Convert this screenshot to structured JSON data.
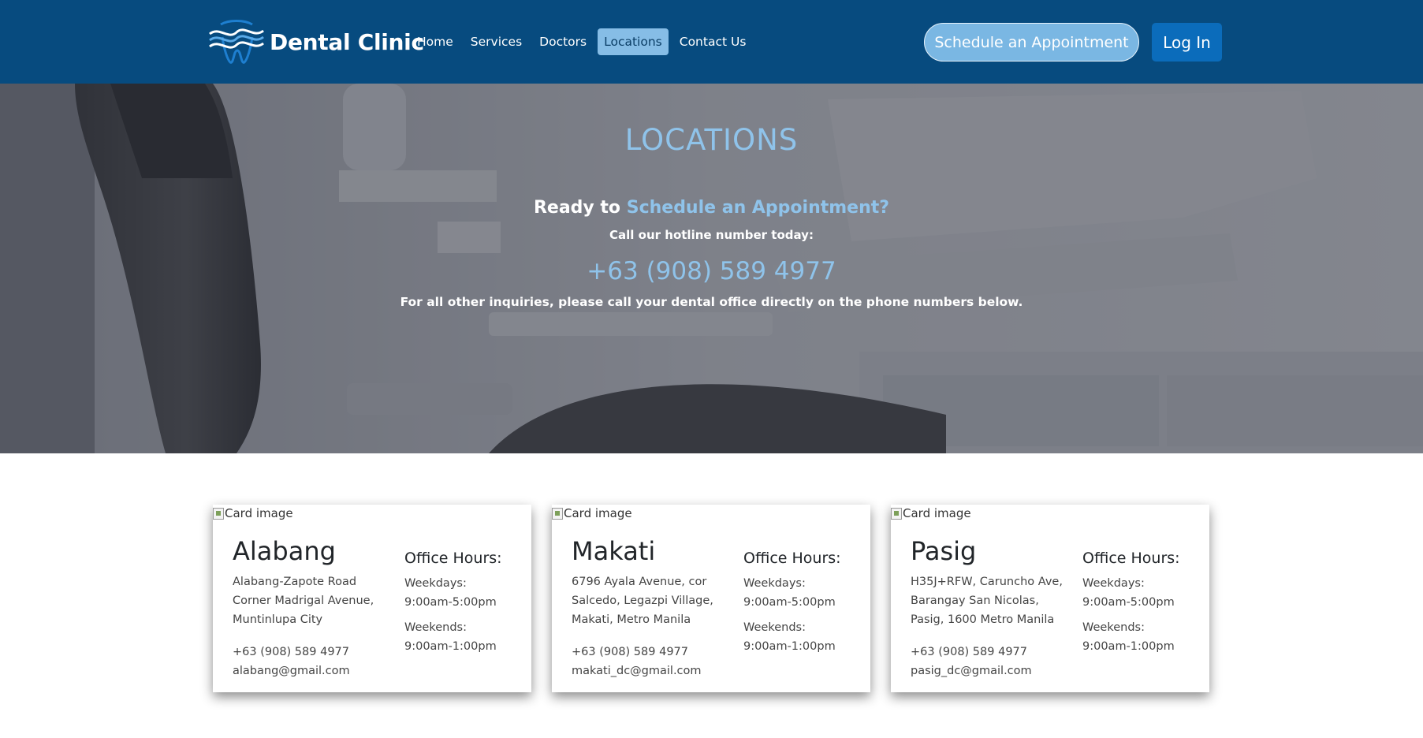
{
  "header": {
    "brand_name": "Dental Clinic",
    "brand_logo_icon": "tooth-waves-icon",
    "nav": [
      {
        "label": "Home",
        "active": false
      },
      {
        "label": "Services",
        "active": false
      },
      {
        "label": "Doctors",
        "active": false
      },
      {
        "label": "Locations",
        "active": true
      },
      {
        "label": "Contact Us",
        "active": false
      }
    ],
    "schedule_button": "Schedule an Appointment",
    "login_button": "Log In"
  },
  "hero": {
    "title": "LOCATIONS",
    "ready_prefix": "Ready to",
    "ready_accent": "Schedule an Appointment?",
    "call_text": "Call our hotline number today:",
    "hotline": "+63 (908) 589 4977",
    "other_inquiries": "For all other inquiries, please call your dental office directly on the phone numbers below."
  },
  "cards": [
    {
      "image_alt": "Card image",
      "city": "Alabang",
      "address_lines": [
        "Alabang-Zapote Road",
        "Corner Madrigal Avenue,",
        "Muntinlupa City"
      ],
      "phone": "+63 (908) 589 4977",
      "email": "alabang@gmail.com",
      "hours_title": "Office Hours:",
      "weekdays_label": "Weekdays:",
      "weekdays_hours": "9:00am-5:00pm",
      "weekends_label": "Weekends:",
      "weekends_hours": "9:00am-1:00pm"
    },
    {
      "image_alt": "Card image",
      "city": "Makati",
      "address_lines": [
        "6796 Ayala Avenue, cor",
        "Salcedo, Legazpi Village,",
        "Makati, Metro Manila"
      ],
      "phone": "+63 (908) 589 4977",
      "email": "makati_dc@gmail.com",
      "hours_title": "Office Hours:",
      "weekdays_label": "Weekdays:",
      "weekdays_hours": "9:00am-5:00pm",
      "weekends_label": "Weekends:",
      "weekends_hours": "9:00am-1:00pm"
    },
    {
      "image_alt": "Card image",
      "city": "Pasig",
      "address_lines": [
        "H35J+RFW, Caruncho Ave,",
        "Barangay San Nicolas,",
        "Pasig, 1600 Metro Manila"
      ],
      "phone": "+63 (908) 589 4977",
      "email": "pasig_dc@gmail.com",
      "hours_title": "Office Hours:",
      "weekdays_label": "Weekdays:",
      "weekdays_hours": "9:00am-5:00pm",
      "weekends_label": "Weekends:",
      "weekends_hours": "9:00am-1:00pm"
    }
  ],
  "colors": {
    "navbar": "#074b7f",
    "accent_light_blue": "#8fc3ea",
    "active_nav": "#86bde6",
    "login_button": "#0b6cbb"
  }
}
